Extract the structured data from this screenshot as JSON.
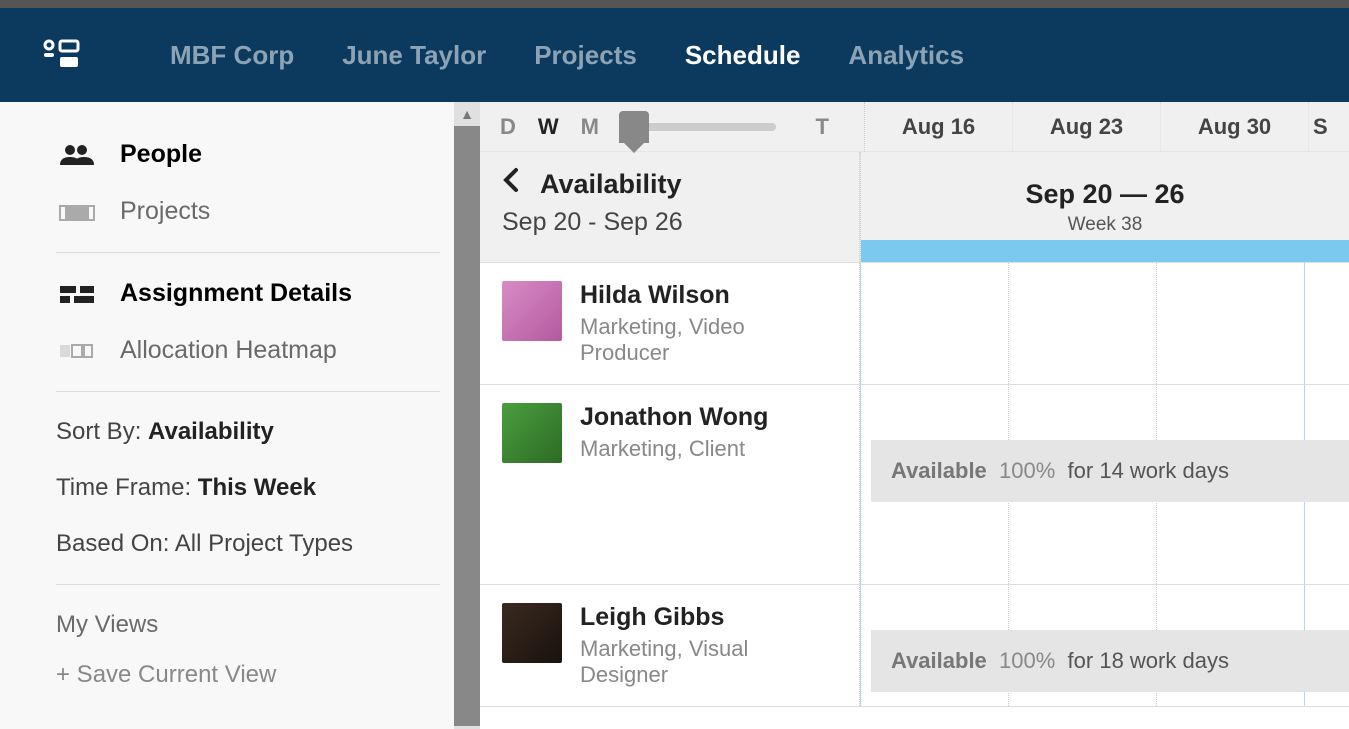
{
  "nav": {
    "items": [
      "MBF Corp",
      "June Taylor",
      "Projects",
      "Schedule",
      "Analytics"
    ],
    "active": "Schedule"
  },
  "sidebar": {
    "people": "People",
    "projects": "Projects",
    "assignment_details": "Assignment Details",
    "allocation_heatmap": "Allocation Heatmap",
    "sort_by_label": "Sort By: ",
    "sort_by_value": "Availability",
    "time_frame_label": "Time Frame: ",
    "time_frame_value": "This Week",
    "based_on_label": "Based On: ",
    "based_on_value": "All Project Types",
    "my_views": "My Views",
    "save_view": "+ Save Current View"
  },
  "timeline": {
    "zoom": {
      "d": "D",
      "w": "W",
      "m": "M",
      "t": "T"
    },
    "dates": [
      "Aug 16",
      "Aug 23",
      "Aug 30"
    ],
    "sep_partial": "S"
  },
  "availability": {
    "back": "‹",
    "title": "Availability",
    "date_range": "Sep 20 - Sep 26",
    "week_title": "Sep 20 — 26",
    "week_num": "Week 38"
  },
  "people": [
    {
      "name": "Hilda Wilson",
      "role": "Marketing, Video Producer",
      "avatar_class": "avatar-1",
      "availability": null
    },
    {
      "name": "Jonathon Wong",
      "role": "Marketing, Client",
      "avatar_class": "avatar-2",
      "availability": {
        "label": "Available",
        "percent": "100%",
        "rest": "for 14 work days"
      }
    },
    {
      "name": "Leigh Gibbs",
      "role": "Marketing, Visual Designer",
      "avatar_class": "avatar-3",
      "availability": {
        "label": "Available",
        "percent": "100%",
        "rest": "for 18 work days"
      }
    }
  ]
}
